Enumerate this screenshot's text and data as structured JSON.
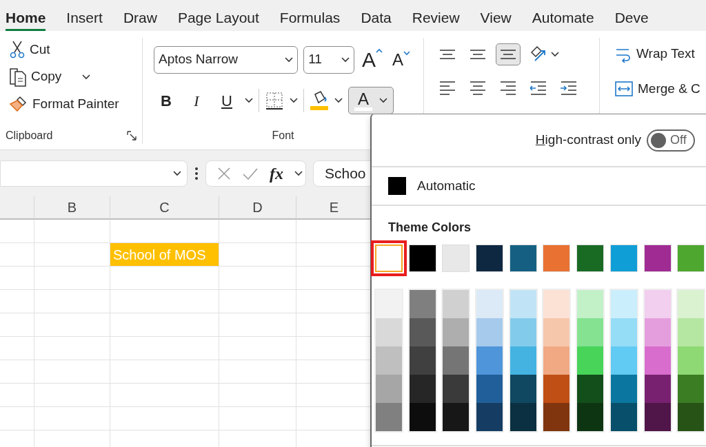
{
  "tabs": [
    {
      "label": "Home",
      "selected": true
    },
    {
      "label": "Insert",
      "selected": false
    },
    {
      "label": "Draw",
      "selected": false
    },
    {
      "label": "Page Layout",
      "selected": false
    },
    {
      "label": "Formulas",
      "selected": false
    },
    {
      "label": "Data",
      "selected": false
    },
    {
      "label": "Review",
      "selected": false
    },
    {
      "label": "View",
      "selected": false
    },
    {
      "label": "Automate",
      "selected": false
    },
    {
      "label": "Deve",
      "selected": false
    }
  ],
  "clipboard": {
    "items": [
      {
        "kind": "cut",
        "label": "Cut",
        "dropdown": false
      },
      {
        "kind": "copy",
        "label": "Copy",
        "dropdown": true
      },
      {
        "kind": "painter",
        "label": "Format Painter",
        "dropdown": false
      }
    ],
    "group_label": "Clipboard"
  },
  "font": {
    "name": "Aptos Narrow",
    "size": "11",
    "grow_glyph": "A",
    "shrink_glyph": "A",
    "format_buttons": [
      {
        "kind": "bold",
        "glyph": "B"
      },
      {
        "kind": "italic",
        "glyph": "I"
      },
      {
        "kind": "underline",
        "glyph": "U"
      }
    ],
    "font_color_glyph": "A",
    "font_color_open": true,
    "group_label": "Font"
  },
  "alignment": [
    {
      "kind": "top",
      "selected": false
    },
    {
      "kind": "middle",
      "selected": false
    },
    {
      "kind": "bottom",
      "selected": true
    },
    {
      "kind": "orientation",
      "selected": false
    },
    {
      "kind": "left",
      "selected": false
    },
    {
      "kind": "center",
      "selected": false
    },
    {
      "kind": "right",
      "selected": false
    },
    {
      "kind": "outdent",
      "selected": false
    },
    {
      "kind": "indent",
      "selected": false
    }
  ],
  "wrap_text": "Wrap Text",
  "merge": "Merge & C",
  "formula_bar": {
    "fx": "fx",
    "content": "Schoo"
  },
  "columns": [
    "B",
    "C",
    "D",
    "E"
  ],
  "cell": {
    "text": "School of MOS"
  },
  "color_menu": {
    "high_contrast": {
      "label": "High-contrast only",
      "on": false,
      "state_text": "Off"
    },
    "automatic": "Automatic",
    "theme_heading": "Theme Colors",
    "theme_colors": [
      {
        "color": "#ffffff",
        "selected": true
      },
      {
        "color": "#000000",
        "selected": false
      },
      {
        "color": "#e8e8e8",
        "selected": false
      },
      {
        "color": "#0e2841",
        "selected": false
      },
      {
        "color": "#156082",
        "selected": false
      },
      {
        "color": "#e97132",
        "selected": false
      },
      {
        "color": "#196b24",
        "selected": false
      },
      {
        "color": "#0f9ed5",
        "selected": false
      },
      {
        "color": "#a02b93",
        "selected": false
      },
      {
        "color": "#4ea72e",
        "selected": false
      }
    ],
    "shades": [
      [
        {
          "color": "#f2f2f2"
        },
        {
          "color": "#d9d9d9"
        },
        {
          "color": "#bfbfbf"
        },
        {
          "color": "#a6a6a6"
        },
        {
          "color": "#808080"
        }
      ],
      [
        {
          "color": "#7f7f7f"
        },
        {
          "color": "#595959"
        },
        {
          "color": "#404040"
        },
        {
          "color": "#262626"
        },
        {
          "color": "#0d0d0d"
        }
      ],
      [
        {
          "color": "#d0d0d0"
        },
        {
          "color": "#aeaeae"
        },
        {
          "color": "#757575"
        },
        {
          "color": "#3a3a3a"
        },
        {
          "color": "#171717"
        }
      ],
      [
        {
          "color": "#dceaf7"
        },
        {
          "color": "#a6caec"
        },
        {
          "color": "#4e95d9"
        },
        {
          "color": "#215f9a"
        },
        {
          "color": "#153d64"
        }
      ],
      [
        {
          "color": "#c0e4f5"
        },
        {
          "color": "#83cbeb"
        },
        {
          "color": "#44b3e1"
        },
        {
          "color": "#104862"
        },
        {
          "color": "#0a3041"
        }
      ],
      [
        {
          "color": "#fbe2d5"
        },
        {
          "color": "#f7c7ac"
        },
        {
          "color": "#f1a983"
        },
        {
          "color": "#c04f15"
        },
        {
          "color": "#80350e"
        }
      ],
      [
        {
          "color": "#c2f1c8"
        },
        {
          "color": "#84e291"
        },
        {
          "color": "#47d459"
        },
        {
          "color": "#124f1a"
        },
        {
          "color": "#0d3512"
        }
      ],
      [
        {
          "color": "#caeefb"
        },
        {
          "color": "#95dcf7"
        },
        {
          "color": "#61cbf3"
        },
        {
          "color": "#0b769f"
        },
        {
          "color": "#074f6a"
        }
      ],
      [
        {
          "color": "#f2ceef"
        },
        {
          "color": "#e59edd"
        },
        {
          "color": "#d86dcd"
        },
        {
          "color": "#782170"
        },
        {
          "color": "#501549"
        }
      ],
      [
        {
          "color": "#daf2d0"
        },
        {
          "color": "#b5e6a2"
        },
        {
          "color": "#8ed973"
        },
        {
          "color": "#3b7d23"
        },
        {
          "color": "#275317"
        }
      ]
    ]
  }
}
